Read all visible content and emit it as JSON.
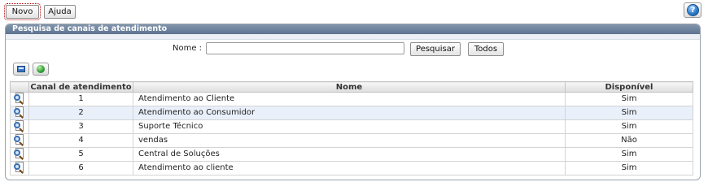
{
  "toolbar": {
    "novo_label": "Novo",
    "ajuda_label": "Ajuda",
    "help_glyph": "?"
  },
  "panel": {
    "title": "Pesquisa de canais de atendimento"
  },
  "search": {
    "label": "Nome :",
    "value": "",
    "pesquisar_label": "Pesquisar",
    "todos_label": "Todos"
  },
  "tools": [
    {
      "icon": "card-icon"
    },
    {
      "icon": "green-ball-icon"
    }
  ],
  "table": {
    "columns": [
      "",
      "Canal de atendimento",
      "Nome",
      "Disponível"
    ],
    "rows": [
      {
        "canal": "1",
        "nome": "Atendimento ao Cliente",
        "disponivel": "Sim"
      },
      {
        "canal": "2",
        "nome": "Atendimento ao Consumidor",
        "disponivel": "Sim"
      },
      {
        "canal": "3",
        "nome": "Suporte Técnico",
        "disponivel": "Sim"
      },
      {
        "canal": "4",
        "nome": "vendas",
        "disponivel": "Não"
      },
      {
        "canal": "5",
        "nome": "Central de Soluções",
        "disponivel": "Sim"
      },
      {
        "canal": "6",
        "nome": "Atendimento ao cliente",
        "disponivel": "Sim"
      }
    ]
  },
  "colors": {
    "panel_header": "#6a7f99",
    "row_highlight": "#e9f0fa",
    "focus_outline": "#c00000"
  }
}
